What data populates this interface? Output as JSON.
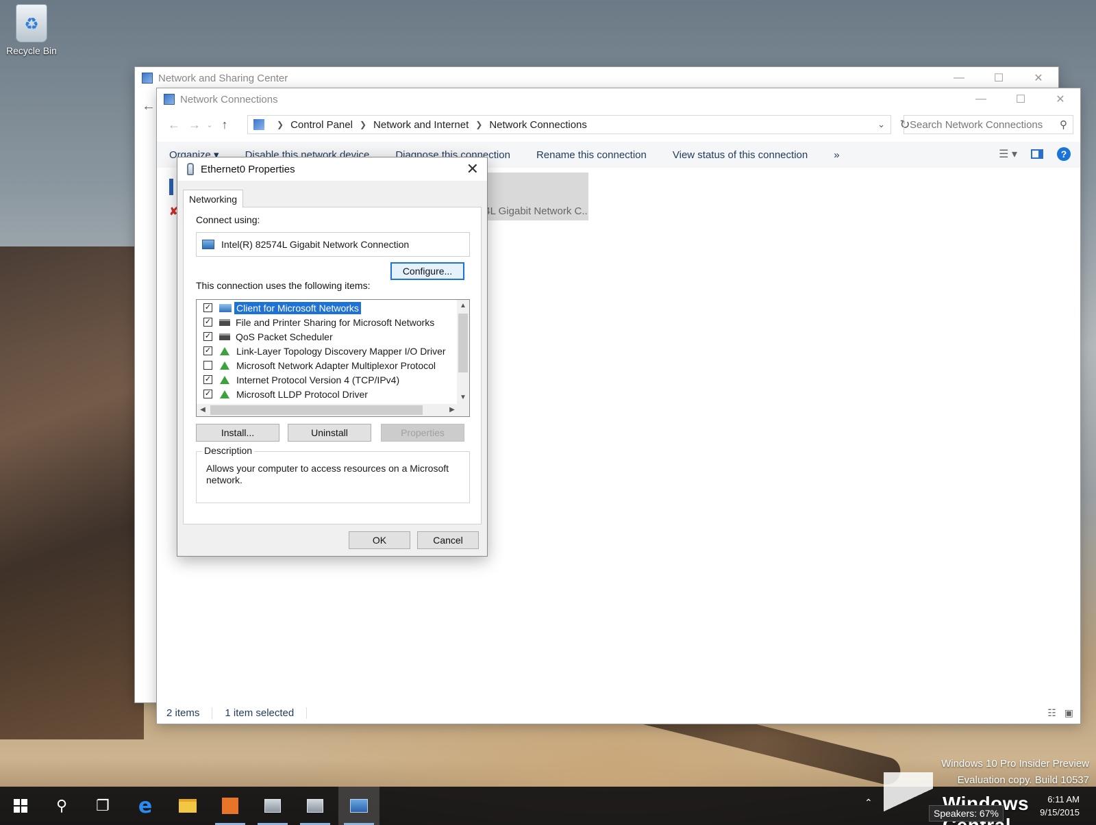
{
  "desktop": {
    "recycle_bin_label": "Recycle Bin"
  },
  "back_window": {
    "title": "Network and Sharing Center"
  },
  "main_window": {
    "title": "Network Connections",
    "breadcrumb": [
      "Control Panel",
      "Network and Internet",
      "Network Connections"
    ],
    "search_placeholder": "Search Network Connections",
    "commands": [
      "Organize ▾",
      "Disable this network device",
      "Diagnose this connection",
      "Rename this connection",
      "View status of this connection",
      "»"
    ],
    "adapter_tile_text": "74L Gigabit Network C...",
    "status": {
      "items": "2 items",
      "selected": "1 item selected"
    }
  },
  "dialog": {
    "title": "Ethernet0 Properties",
    "tab_label": "Networking",
    "connect_using_label": "Connect using:",
    "adapter_name": "Intel(R) 82574L Gigabit Network Connection",
    "configure_label": "Configure...",
    "items_label": "This connection uses the following items:",
    "items": [
      {
        "label": "Client for Microsoft Networks",
        "checked": true,
        "icon": "client-icon",
        "selected": true
      },
      {
        "label": "File and Printer Sharing for Microsoft Networks",
        "checked": true,
        "icon": "service-icon",
        "selected": false
      },
      {
        "label": "QoS Packet Scheduler",
        "checked": true,
        "icon": "service-icon",
        "selected": false
      },
      {
        "label": "Link-Layer Topology Discovery Mapper I/O Driver",
        "checked": true,
        "icon": "protocol-icon",
        "selected": false
      },
      {
        "label": "Microsoft Network Adapter Multiplexor Protocol",
        "checked": false,
        "icon": "protocol-icon",
        "selected": false
      },
      {
        "label": "Internet Protocol Version 4 (TCP/IPv4)",
        "checked": true,
        "icon": "protocol-icon",
        "selected": false
      },
      {
        "label": "Microsoft LLDP Protocol Driver",
        "checked": true,
        "icon": "protocol-icon",
        "selected": false
      }
    ],
    "install_label": "Install...",
    "uninstall_label": "Uninstall",
    "properties_label": "Properties",
    "description_legend": "Description",
    "description_text": "Allows your computer to access resources on a Microsoft network.",
    "ok_label": "OK",
    "cancel_label": "Cancel"
  },
  "watermark": {
    "line1": "Windows 10 Pro Insider Preview",
    "line2": "Evaluation copy. Build 10537"
  },
  "taskbar": {
    "clock_time": "6:11 AM",
    "clock_date": "9/15/2015",
    "speakers_tooltip": "Speakers: 67%",
    "brand_text": "Windows Central"
  },
  "colors": {
    "accent": "#1e72d6",
    "taskbar": "#101012",
    "link_text": "#1f3a5c"
  }
}
